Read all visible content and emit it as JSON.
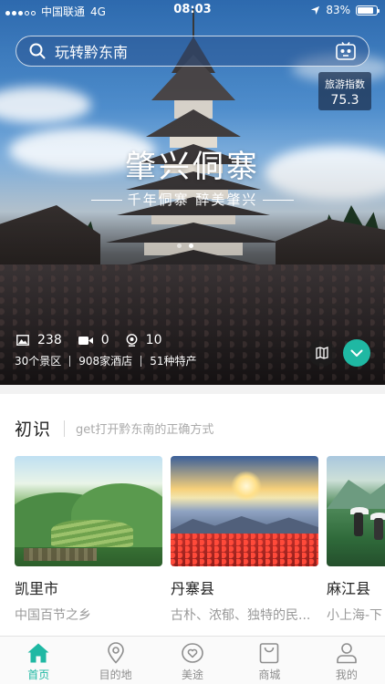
{
  "status_bar": {
    "carrier": "中国联通",
    "network": "4G",
    "time": "08:03",
    "battery": "83%"
  },
  "search": {
    "placeholder": "玩转黔东南",
    "icons": [
      "search-icon",
      "scan-icon"
    ]
  },
  "tourism_index": {
    "label": "旅游指数",
    "value": "75.3"
  },
  "hero": {
    "title": "肇兴侗寨",
    "subtitle": "千年侗寨 醉美肇兴",
    "carousel_pages": 2,
    "carousel_active": 1
  },
  "stats": [
    {
      "icon": "image-icon",
      "value": "238"
    },
    {
      "icon": "video-icon",
      "value": "0"
    },
    {
      "icon": "panorama-icon",
      "value": "10"
    }
  ],
  "facts": [
    "30个景区",
    "908家酒店",
    "51种特产"
  ],
  "section": {
    "title": "初识",
    "subtitle": "get打开黔东南的正确方式"
  },
  "cards": [
    {
      "name": "凯里市",
      "desc": "中国百节之乡"
    },
    {
      "name": "丹寨县",
      "desc": "古朴、浓郁、独特的民..."
    },
    {
      "name": "麻江县",
      "desc": "小上海-下"
    }
  ],
  "tabs": [
    {
      "label": "首页",
      "icon": "home-icon",
      "active": true
    },
    {
      "label": "目的地",
      "icon": "location-pin-icon",
      "active": false
    },
    {
      "label": "美途",
      "icon": "heart-icon",
      "active": false
    },
    {
      "label": "商城",
      "icon": "shopping-bag-icon",
      "active": false
    },
    {
      "label": "我的",
      "icon": "user-icon",
      "active": false
    }
  ],
  "colors": {
    "accent": "#1fb8a3",
    "inactive_tab": "#8d8d8d"
  }
}
